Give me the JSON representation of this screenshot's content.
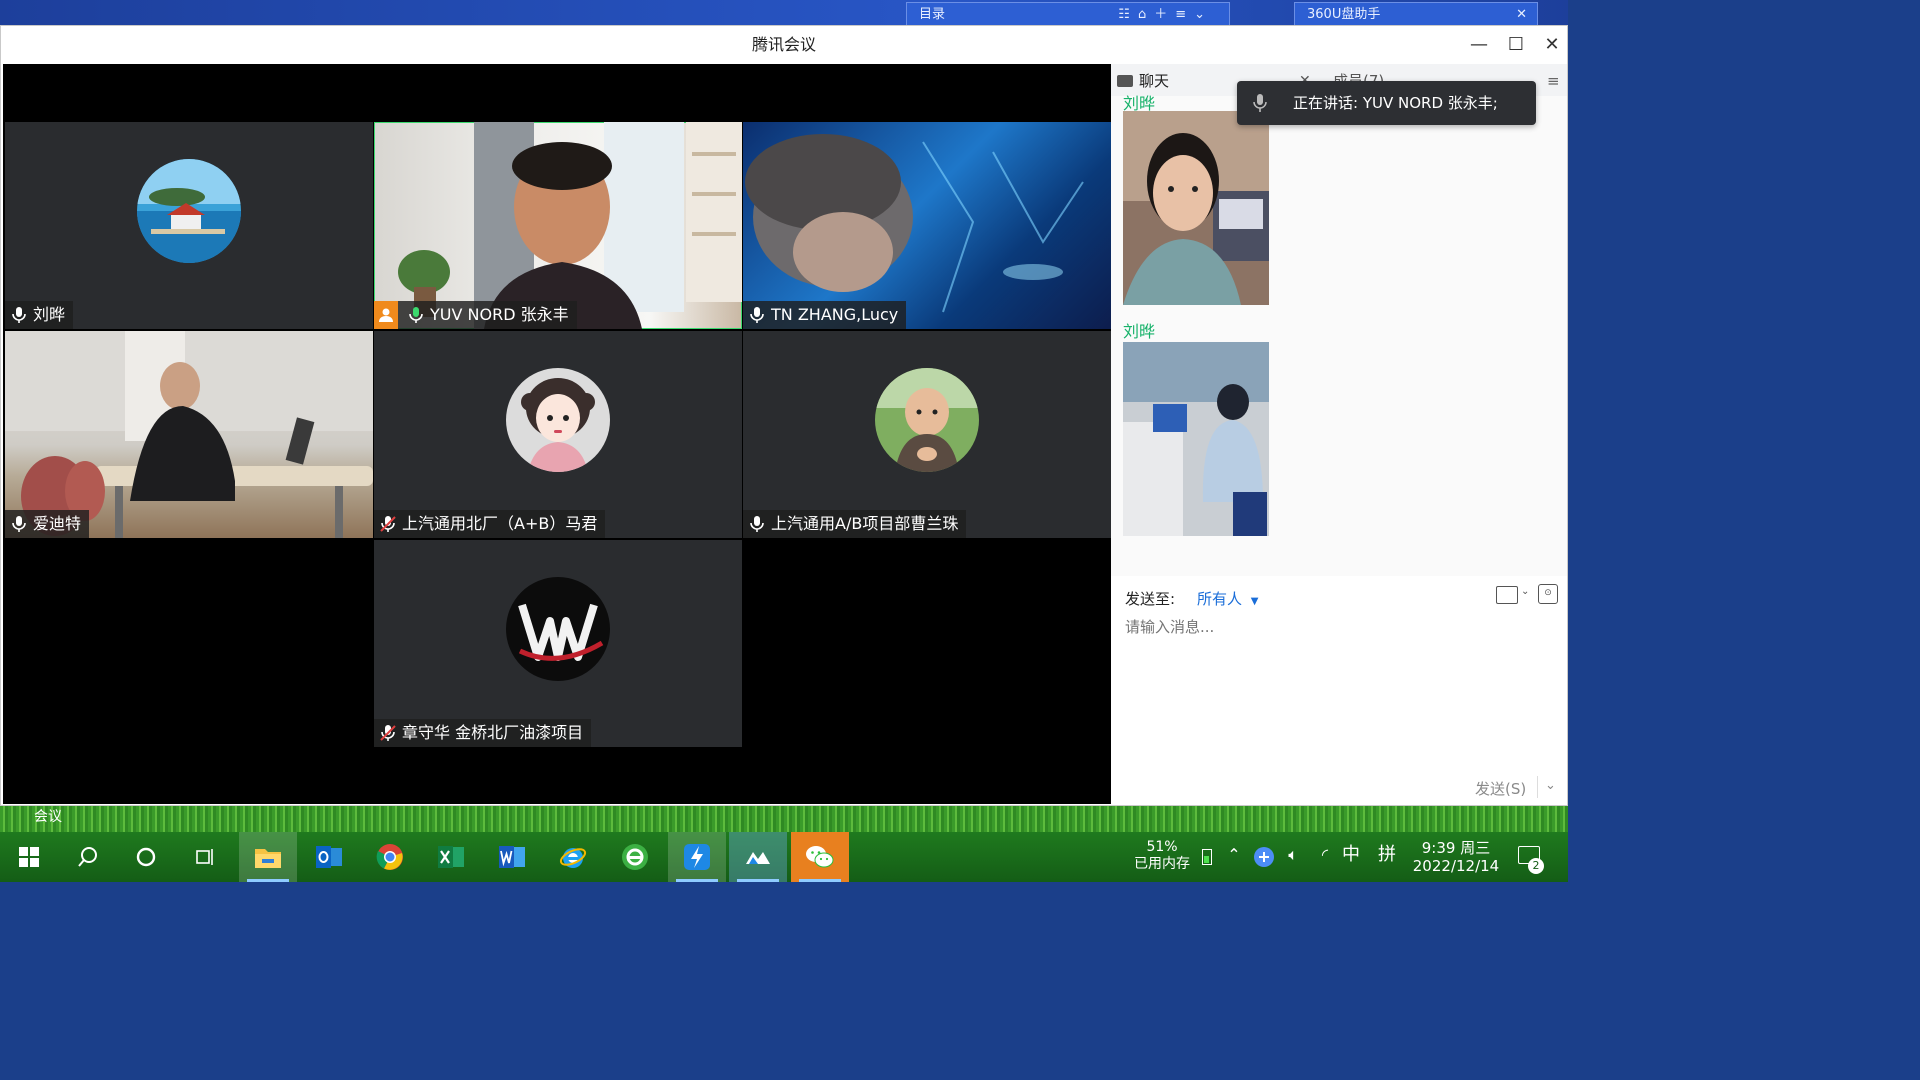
{
  "background_windows": {
    "left_label": "目录",
    "right_label": "360U盘助手"
  },
  "window": {
    "title": "腾讯会议"
  },
  "participants": [
    {
      "name": "刘晔"
    },
    {
      "name": "YUV NORD 张永丰",
      "host": true,
      "speaking": true
    },
    {
      "name": "TN ZHANG,Lucy"
    },
    {
      "name": "爱迪特"
    },
    {
      "name": "上汽通用北厂（A+B）马君",
      "muted": true
    },
    {
      "name": "上汽通用A/B项目部曹兰珠"
    },
    {
      "name": "章守华 金桥北厂油漆项目",
      "muted": true
    }
  ],
  "side_panel": {
    "chat_tab": "聊天",
    "members_tab": "成员(7)",
    "speaking_notice": "正在讲话: YUV NORD 张永丰;",
    "messages": [
      {
        "sender": "刘晔"
      },
      {
        "sender": "刘晔"
      }
    ],
    "send_to_label": "发送至:",
    "send_to_value": "所有人",
    "input_placeholder": "请输入消息...",
    "send_button": "发送(S)"
  },
  "desktop": {
    "corner_label": "会议"
  },
  "taskbar": {
    "memory_percent": "51%",
    "memory_label": "已用内存",
    "ime_lang": "中",
    "ime_mode": "拼",
    "time": "9:39 周三",
    "date": "2022/12/14",
    "notification_count": "2"
  },
  "colors": {
    "accent_green": "#17b26a",
    "link_blue": "#1a6dd8",
    "host_orange": "#f08a1c",
    "muted_red": "#e04040"
  }
}
